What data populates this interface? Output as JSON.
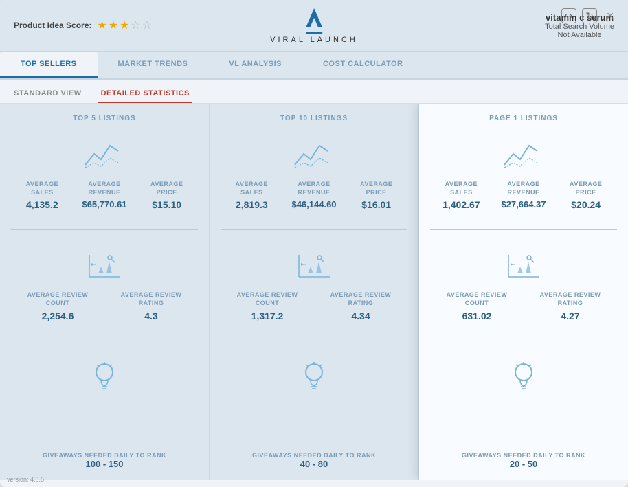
{
  "header": {
    "product_score_label": "Product Idea Score:",
    "stars": [
      "filled",
      "filled",
      "half",
      "empty",
      "empty"
    ],
    "logo_text": "VIRAL LAUNCH",
    "product_name": "vitamin c serum",
    "product_subtitle_1": "Total Search Volume",
    "product_subtitle_2": "Not Available",
    "icon_login": "↪",
    "icon_refresh": "↻",
    "icon_close": "×"
  },
  "tabs": [
    {
      "label": "TOP SELLERS",
      "active": true
    },
    {
      "label": "MARKET TRENDS",
      "active": false
    },
    {
      "label": "VL ANALYSIS",
      "active": false
    },
    {
      "label": "COST CALCULATOR",
      "active": false
    }
  ],
  "sub_tabs": [
    {
      "label": "STANDARD VIEW",
      "active": false
    },
    {
      "label": "DETAILED STATISTICS",
      "active": true
    }
  ],
  "columns": [
    {
      "title": "TOP 5 LISTINGS",
      "avg_sales_label": "AVERAGE\nSALES",
      "avg_sales_value": "4,135.2",
      "avg_revenue_label": "AVERAGE\nREVENUE",
      "avg_revenue_value": "$65,770.61",
      "avg_price_label": "AVERAGE\nPRICE",
      "avg_price_value": "$15.10",
      "avg_review_count_label": "AVERAGE REVIEW\nCOUNT",
      "avg_review_count_value": "2,254.6",
      "avg_review_rating_label": "AVERAGE REVIEW\nRATING",
      "avg_review_rating_value": "4.3",
      "giveaways_label": "GIVEAWAYS NEEDED DAILY TO RANK",
      "giveaways_value": "100 - 150"
    },
    {
      "title": "TOP 10 LISTINGS",
      "avg_sales_label": "AVERAGE\nSALES",
      "avg_sales_value": "2,819.3",
      "avg_revenue_label": "AVERAGE\nREVENUE",
      "avg_revenue_value": "$46,144.60",
      "avg_price_label": "AVERAGE\nPRICE",
      "avg_price_value": "$16.01",
      "avg_review_count_label": "AVERAGE REVIEW\nCOUNT",
      "avg_review_count_value": "1,317.2",
      "avg_review_rating_label": "AVERAGE REVIEW\nRATING",
      "avg_review_rating_value": "4.34",
      "giveaways_label": "GIVEAWAYS NEEDED DAILY TO RANK",
      "giveaways_value": "40 - 80"
    },
    {
      "title": "PAGE 1 LISTINGS",
      "avg_sales_label": "AVERAGE\nSALES",
      "avg_sales_value": "1,402.67",
      "avg_revenue_label": "AVERAGE\nREVENUE",
      "avg_revenue_value": "$27,664.37",
      "avg_price_label": "AVERAGE\nPRICE",
      "avg_price_value": "$20.24",
      "avg_review_count_label": "AVERAGE REVIEW\nCOUNT",
      "avg_review_count_value": "631.02",
      "avg_review_rating_label": "AVERAGE REVIEW\nRATING",
      "avg_review_rating_value": "4.27",
      "giveaways_label": "GIVEAWAYS NEEDED DAILY TO RANK",
      "giveaways_value": "20 - 50"
    }
  ],
  "version": "version: 4.0.5"
}
